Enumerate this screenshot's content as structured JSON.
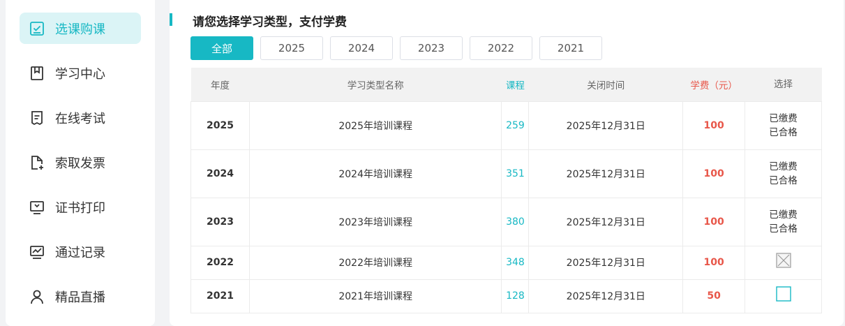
{
  "sidebar": {
    "items": [
      {
        "label": "选课购课",
        "icon": "checkbox-icon",
        "active": true
      },
      {
        "label": "学习中心",
        "icon": "bookmark-icon",
        "active": false
      },
      {
        "label": "在线考试",
        "icon": "document-icon",
        "active": false
      },
      {
        "label": "索取发票",
        "icon": "file-add-icon",
        "active": false
      },
      {
        "label": "证书打印",
        "icon": "monitor-icon",
        "active": false
      },
      {
        "label": "通过记录",
        "icon": "chart-icon",
        "active": false
      },
      {
        "label": "精品直播",
        "icon": "user-icon",
        "active": false
      }
    ]
  },
  "main": {
    "title": "请您选择学习类型，支付学费",
    "tabs": [
      "全部",
      "2025",
      "2024",
      "2023",
      "2022",
      "2021"
    ],
    "active_tab": 0,
    "table": {
      "headers": [
        "年度",
        "学习类型名称",
        "课程",
        "关闭时间",
        "学费（元）",
        "选择"
      ],
      "rows": [
        {
          "year": "2025",
          "name": "2025年培训课程",
          "courses": "259",
          "close": "2025年12月31日",
          "fee": "100",
          "status1": "已缴费",
          "status2": "已合格"
        },
        {
          "year": "2024",
          "name": "2024年培训课程",
          "courses": "351",
          "close": "2025年12月31日",
          "fee": "100",
          "status1": "已缴费",
          "status2": "已合格"
        },
        {
          "year": "2023",
          "name": "2023年培训课程",
          "courses": "380",
          "close": "2025年12月31日",
          "fee": "100",
          "status1": "已缴费",
          "status2": "已合格"
        },
        {
          "year": "2022",
          "name": "2022年培训课程",
          "courses": "348",
          "close": "2025年12月31日",
          "fee": "100",
          "select": "disabled"
        },
        {
          "year": "2021",
          "name": "2021年培训课程",
          "courses": "128",
          "close": "2025年12月31日",
          "fee": "50",
          "select": "unchecked"
        }
      ]
    }
  },
  "colors": {
    "accent": "#17b8c4",
    "fee": "#e8574a",
    "active_bg": "#dbf4f6"
  }
}
